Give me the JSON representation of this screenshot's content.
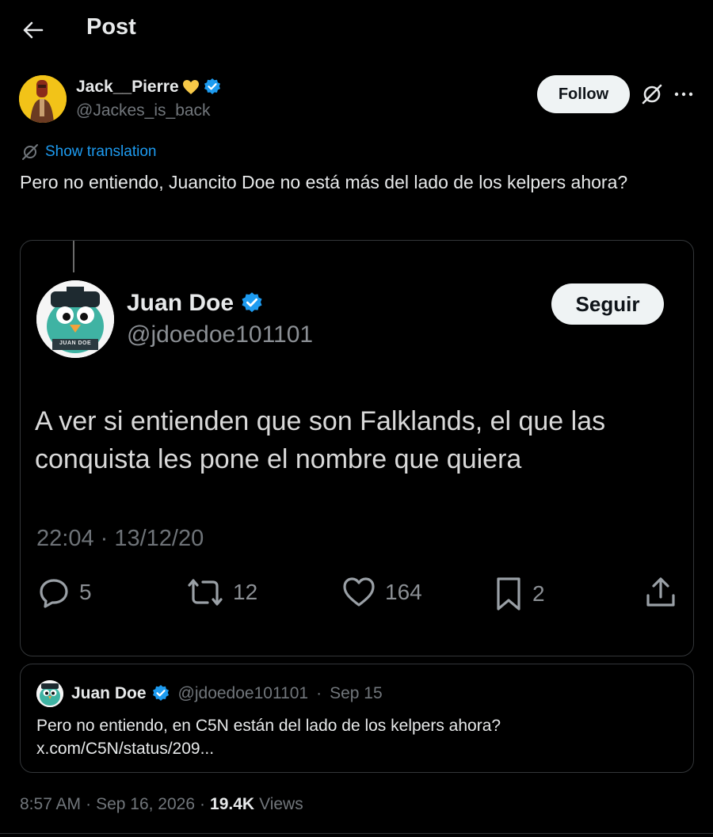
{
  "header": {
    "title": "Post"
  },
  "author": {
    "name": "Jack__Pierre",
    "handle": "@Jackes_is_back",
    "follow_label": "Follow"
  },
  "translation": {
    "label": "Show translation"
  },
  "post": {
    "text": "Pero no entiendo, Juancito Doe no está más del lado de los kelpers ahora?"
  },
  "embedded_screenshot": {
    "name": "Juan Doe",
    "handle": "@jdoedoe101101",
    "follow_label": "Seguir",
    "avatar_caption": "JUAN DOE",
    "text": "A ver si entienden que son Falklands, el que las conquista les pone el nombre que quiera",
    "timestamp": "22:04 · 13/12/20",
    "replies": "5",
    "reposts": "12",
    "likes": "164",
    "bookmarks": "2"
  },
  "quote": {
    "name": "Juan Doe",
    "handle": "@jdoedoe101101",
    "separator": "·",
    "date": "Sep 15",
    "text_line1": "Pero no entiendo, en C5N están del lado de los kelpers ahora?",
    "text_line2": "x.com/C5N/status/209..."
  },
  "meta": {
    "time": "8:57 AM",
    "date": "Sep 16, 2026",
    "separator": "·",
    "views_count": "19.4K",
    "views_label": "Views"
  },
  "colors": {
    "background": "#000000",
    "accent": "#1d9bf0",
    "verified": "#1d9bf0",
    "secondary_text": "#71767b",
    "heart_emoji": "#f7c948"
  },
  "icons": [
    "back-arrow-icon",
    "verified-badge-icon",
    "yellow-heart-icon",
    "grok-icon",
    "more-icon",
    "translate-icon",
    "reply-icon",
    "repost-icon",
    "like-icon",
    "bookmark-icon",
    "share-icon"
  ]
}
